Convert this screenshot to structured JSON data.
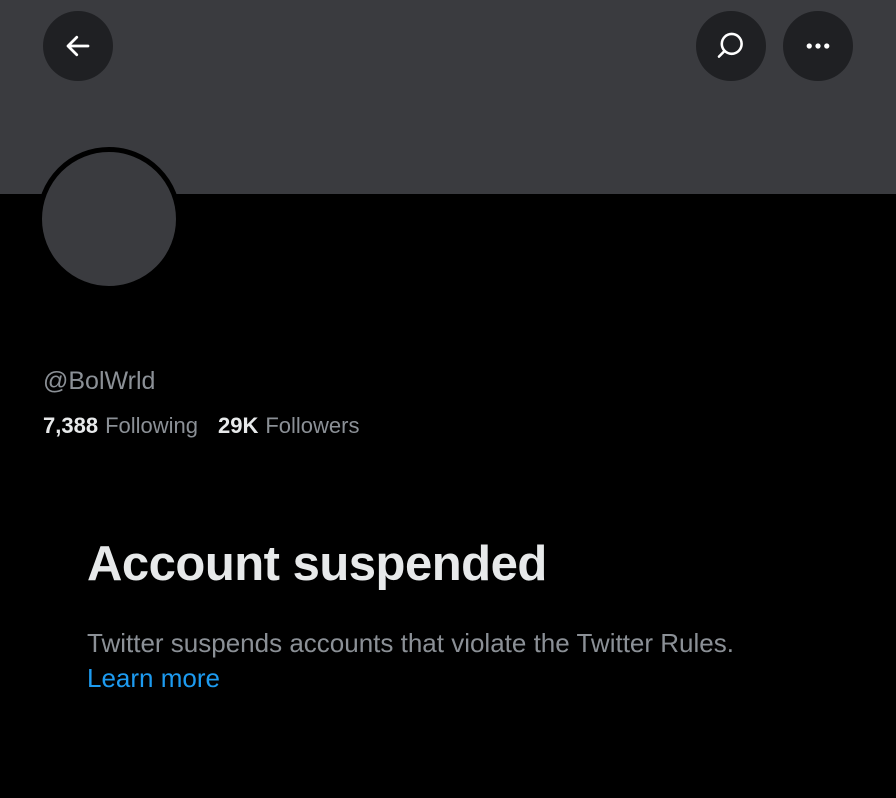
{
  "header": {
    "back_icon": "arrow-left-icon",
    "search_icon": "search-icon",
    "more_icon": "more-horizontal-icon"
  },
  "profile": {
    "handle": "@BolWrld",
    "following_count": "7,388",
    "following_label": "Following",
    "followers_count": "29K",
    "followers_label": "Followers"
  },
  "notice": {
    "title": "Account suspended",
    "body": "Twitter suspends accounts that violate the Twitter Rules.",
    "link": "Learn more"
  },
  "colors": {
    "background": "#000000",
    "banner": "#3a3b3f",
    "button": "#1f2023",
    "text_primary": "#e7e9ea",
    "text_secondary": "#8b9096",
    "link": "#1d9bf0"
  }
}
